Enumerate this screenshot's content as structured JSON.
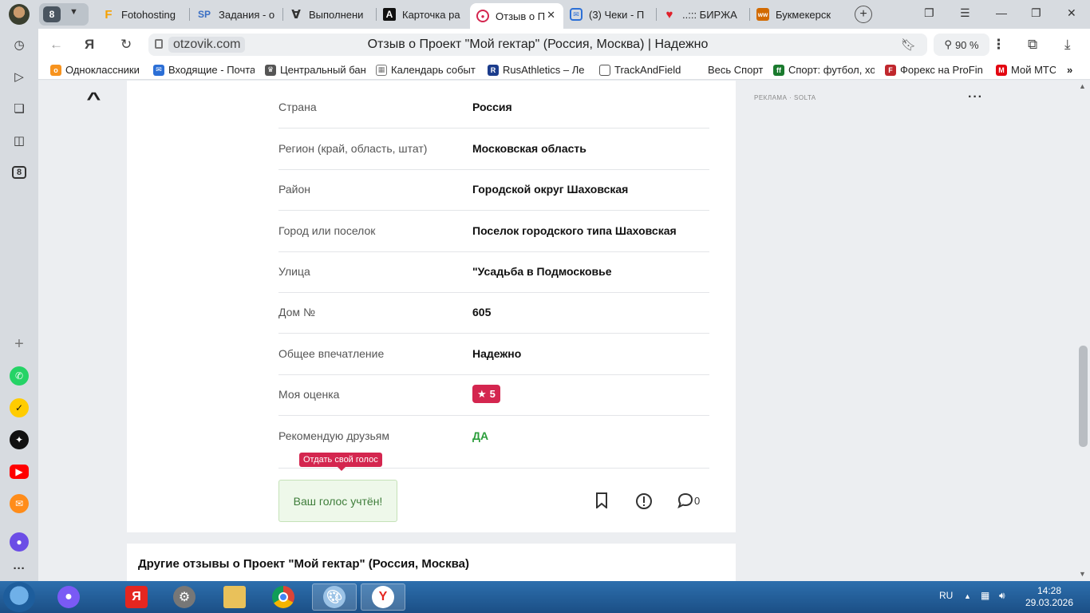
{
  "browser": {
    "tab_group_count": "8",
    "tabs": [
      {
        "label": "Fotohosting",
        "icon": "F",
        "color": "#f5a000"
      },
      {
        "label": "Задания - о",
        "icon": "SP",
        "color": "#3a6fc4"
      },
      {
        "label": "Выполнени",
        "icon": "∀",
        "color": "#333333"
      },
      {
        "label": "Карточка ра",
        "icon": "A",
        "color": "#111111"
      },
      {
        "label": "Отзыв о П",
        "icon": "◉",
        "color": "#d4264f"
      },
      {
        "label": "(3) Чеки - П",
        "icon": "✉",
        "color": "#2c6fd6"
      },
      {
        "label": "..::: БИРЖА",
        "icon": "♥",
        "color": "#e0202a"
      },
      {
        "label": "Букмекерск",
        "icon": "ww",
        "color": "#d26a00"
      }
    ],
    "address": {
      "domain": "otzovik.com",
      "page_title": "Отзыв о Проект \"Мой гектар\" (Россия, Москва) | Надежно"
    },
    "zoom": "90 %",
    "bookmarks": [
      {
        "label": "Одноклассники",
        "color": "#f7931e"
      },
      {
        "label": "Входящие - Почта",
        "color": "#2c6fd6"
      },
      {
        "label": "Центральный бан",
        "color": "#555555"
      },
      {
        "label": "Календарь событ",
        "color": "#777777"
      },
      {
        "label": "RusAthletics – Ле",
        "color": "#1b3c8c"
      },
      {
        "label": "TrackAndField",
        "color": "#ffffff"
      },
      {
        "label": "Весь Спорт",
        "color": "#ffffff"
      },
      {
        "label": "Спорт: футбол, хо",
        "color": "#1a7a2e"
      },
      {
        "label": "Форекс на ProFin",
        "color": "#c0272d"
      },
      {
        "label": "Мой МТС",
        "color": "#e30611"
      }
    ]
  },
  "review": {
    "rows": [
      {
        "key": "Страна",
        "value": "Россия"
      },
      {
        "key": "Регион (край, область, штат)",
        "value": "Московская область"
      },
      {
        "key": "Район",
        "value": "Городской округ Шаховская"
      },
      {
        "key": "Город или поселок",
        "value": "Поселок городского типа Шаховская"
      },
      {
        "key": "Улица",
        "value": "\"Усадьба в Подмосковье"
      },
      {
        "key": "Дом №",
        "value": "605"
      },
      {
        "key": "Общее впечатление",
        "value": "Надежно"
      },
      {
        "key": "Моя оценка",
        "value": "5"
      },
      {
        "key": "Рекомендую друзьям",
        "value": "ДА"
      }
    ],
    "vote_tooltip": "Отдать свой голос",
    "vote_status": "Ваш голос учтён!",
    "comment_count": "0"
  },
  "other_reviews_heading": "Другие отзывы о Проект \"Мой гектар\" (Россия, Москва)",
  "ad": {
    "label": "РЕКЛАМА · SOLTA"
  },
  "taskbar": {
    "language": "RU",
    "time": "14:28",
    "date": "29.03.2026"
  }
}
